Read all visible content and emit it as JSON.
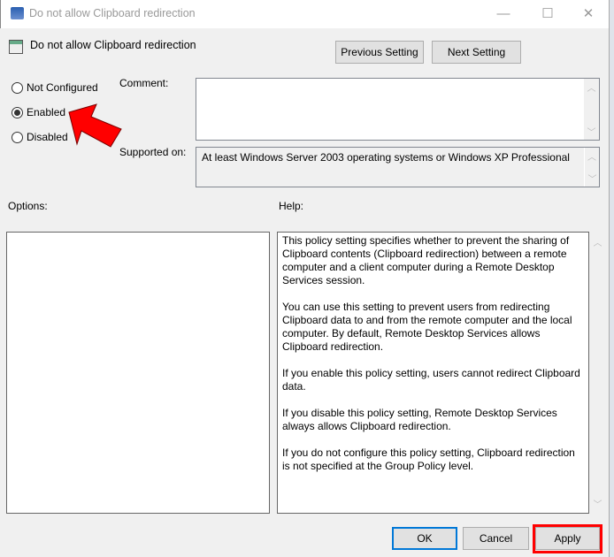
{
  "window": {
    "title": "Do not allow Clipboard redirection",
    "minimize": "—",
    "maximize": "☐",
    "close": "✕"
  },
  "header": {
    "title": "Do not allow Clipboard redirection",
    "prev_label": "Previous Setting",
    "next_label": "Next Setting"
  },
  "radios": [
    {
      "label": "Not Configured",
      "checked": false
    },
    {
      "label": "Enabled",
      "checked": true
    },
    {
      "label": "Disabled",
      "checked": false
    }
  ],
  "comment": {
    "label": "Comment:",
    "value": ""
  },
  "supported": {
    "label": "Supported on:",
    "value": "At least Windows Server 2003 operating systems or Windows XP Professional"
  },
  "options": {
    "label": "Options:"
  },
  "help": {
    "label": "Help:",
    "paragraphs": [
      "This policy setting specifies whether to prevent the sharing of Clipboard contents (Clipboard redirection) between a remote computer and a client computer during a Remote Desktop Services session.",
      "You can use this setting to prevent users from redirecting Clipboard data to and from the remote computer and the local computer. By default, Remote Desktop Services allows Clipboard redirection.",
      "If you enable this policy setting, users cannot redirect Clipboard data.",
      "If you disable this policy setting, Remote Desktop Services always allows Clipboard redirection.",
      "If you do not configure this policy setting, Clipboard redirection is not specified at the Group Policy level."
    ]
  },
  "footer": {
    "ok": "OK",
    "cancel": "Cancel",
    "apply": "Apply"
  },
  "colors": {
    "annotation": "#ff0000",
    "focus": "#0078d7"
  }
}
